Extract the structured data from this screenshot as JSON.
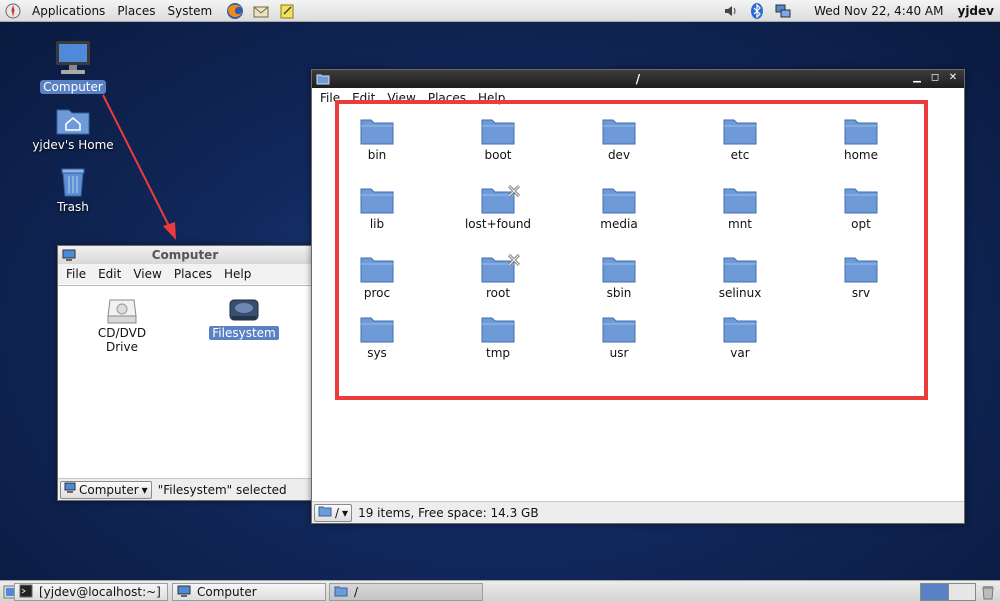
{
  "top_panel": {
    "menus": [
      "Applications",
      "Places",
      "System"
    ],
    "clock": "Wed Nov 22,  4:40 AM",
    "user": "yjdev"
  },
  "desktop": {
    "icons": [
      {
        "label": "Computer",
        "icon": "computer-icon"
      },
      {
        "label": "yjdev's Home",
        "icon": "home-folder-icon"
      },
      {
        "label": "Trash",
        "icon": "trash-icon"
      }
    ]
  },
  "computer_window": {
    "title": "Computer",
    "menu": [
      "File",
      "Edit",
      "View",
      "Places",
      "Help"
    ],
    "items": [
      {
        "label": "CD/DVD Drive",
        "icon": "cd-drive-icon"
      },
      {
        "label": "Filesystem",
        "icon": "harddisk-icon"
      }
    ],
    "location_combo": "Computer",
    "status": "\"Filesystem\" selected"
  },
  "fs_window": {
    "title": "/",
    "menu": [
      "File",
      "Edit",
      "View",
      "Places",
      "Help"
    ],
    "folders": [
      "bin",
      "boot",
      "dev",
      "etc",
      "home",
      "lib",
      "lost+found",
      "media",
      "mnt",
      "opt",
      "proc",
      "root",
      "sbin",
      "selinux",
      "srv",
      "sys",
      "tmp",
      "usr",
      "var"
    ],
    "locked": [
      "lost+found",
      "root"
    ],
    "location_combo": "/",
    "status": "19 items, Free space: 14.3 GB"
  },
  "bottom_panel": {
    "tasks": [
      {
        "label": "[yjdev@localhost:~]",
        "icon": "terminal-icon"
      },
      {
        "label": "Computer",
        "icon": "computer-icon"
      },
      {
        "label": "/",
        "icon": "folder-icon"
      }
    ]
  },
  "colors": {
    "annotation_red": "#ec3b3b",
    "selection_blue": "#5a81c4",
    "folder_blue": "#6e9bd8"
  }
}
